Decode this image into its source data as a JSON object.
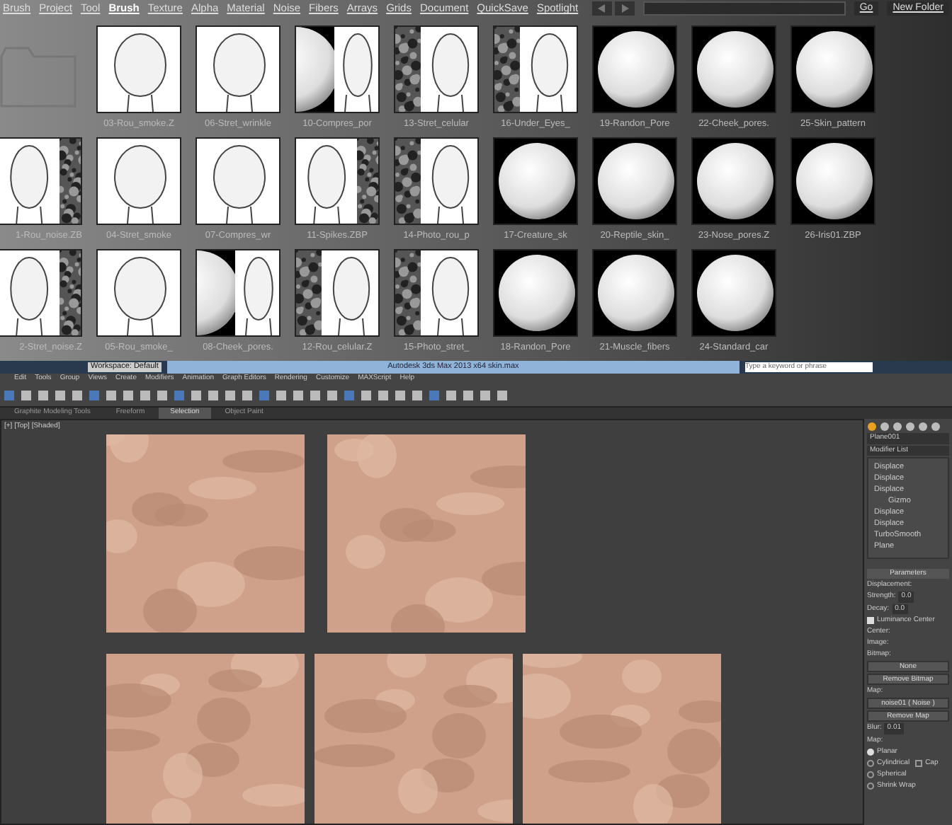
{
  "zbrush": {
    "menu": [
      {
        "label": "Brush",
        "selected": false
      },
      {
        "label": "Project",
        "selected": false
      },
      {
        "label": "Tool",
        "selected": false
      },
      {
        "label": "Brush",
        "selected": true
      },
      {
        "label": "Texture",
        "selected": false
      },
      {
        "label": "Alpha",
        "selected": false
      },
      {
        "label": "Material",
        "selected": false
      },
      {
        "label": "Noise",
        "selected": false
      },
      {
        "label": "Fibers",
        "selected": false
      },
      {
        "label": "Arrays",
        "selected": false
      },
      {
        "label": "Grids",
        "selected": false
      },
      {
        "label": "Document",
        "selected": false
      },
      {
        "label": "QuickSave",
        "selected": false
      },
      {
        "label": "Spotlight",
        "selected": false
      }
    ],
    "go_button": "Go",
    "new_folder_button": "New Folder",
    "rows": [
      {
        "lead": {
          "kind": "folder"
        },
        "items": [
          {
            "kind": "face",
            "label": "03-Rou_smoke.Z"
          },
          {
            "kind": "face",
            "label": "06-Stret_wrinkle"
          },
          {
            "kind": "sphere-face",
            "label": "10-Compres_por"
          },
          {
            "kind": "noise-face",
            "label": "13-Stret_celular"
          },
          {
            "kind": "noise-face",
            "label": "16-Under_Eyes_"
          },
          {
            "kind": "sphere",
            "label": "19-Randon_Pore"
          },
          {
            "kind": "sphere",
            "label": "22-Cheek_pores."
          },
          {
            "kind": "sphere",
            "label": "25-Skin_pattern"
          }
        ]
      },
      {
        "lead": {
          "kind": "face-noise",
          "label": "1-Rou_noise.ZB"
        },
        "items": [
          {
            "kind": "face",
            "label": "04-Stret_smoke"
          },
          {
            "kind": "face",
            "label": "07-Compres_wr"
          },
          {
            "kind": "face-noise",
            "label": "11-Spikes.ZBP"
          },
          {
            "kind": "noise-face",
            "label": "14-Photo_rou_p"
          },
          {
            "kind": "sphere",
            "label": "17-Creature_sk"
          },
          {
            "kind": "sphere",
            "label": "20-Reptile_skin_"
          },
          {
            "kind": "sphere",
            "label": "23-Nose_pores.Z"
          },
          {
            "kind": "sphere",
            "label": "26-Iris01.ZBP"
          }
        ]
      },
      {
        "lead": {
          "kind": "face-noise",
          "label": "2-Stret_noise.Z"
        },
        "items": [
          {
            "kind": "face",
            "label": "05-Rou_smoke_"
          },
          {
            "kind": "sphere-face",
            "label": "08-Cheek_pores."
          },
          {
            "kind": "noise-face",
            "label": "12-Rou_celular.Z"
          },
          {
            "kind": "noise-face",
            "label": "15-Photo_stret_"
          },
          {
            "kind": "sphere",
            "label": "18-Randon_Pore"
          },
          {
            "kind": "sphere",
            "label": "21-Muscle_fibers"
          },
          {
            "kind": "sphere",
            "label": "24-Standard_car"
          }
        ]
      }
    ]
  },
  "max": {
    "workspace": "Workspace: Default",
    "title": "Autodesk 3ds Max 2013 x64    skin.max",
    "search": {
      "placeholder": "Type a keyword or phrase"
    },
    "menu": [
      "Edit",
      "Tools",
      "Group",
      "Views",
      "Create",
      "Modifiers",
      "Animation",
      "Graph Editors",
      "Rendering",
      "Customize",
      "MAXScript",
      "Help"
    ],
    "ribbon_tabs": [
      {
        "label": "Graphite Modeling Tools",
        "selected": false
      },
      {
        "label": "Freeform",
        "selected": false
      },
      {
        "label": "Selection",
        "selected": true
      },
      {
        "label": "Object Paint",
        "selected": false
      }
    ],
    "viewport_label": "[+] [Top] [Shaded]",
    "panel": {
      "object_name": "Plane001",
      "modifier_list": "Modifier List",
      "stack": [
        {
          "label": "Displace"
        },
        {
          "label": "Displace"
        },
        {
          "label": "Displace",
          "children": [
            {
              "label": "Gizmo"
            }
          ]
        },
        {
          "label": "Displace"
        },
        {
          "label": "Displace"
        },
        {
          "label": "TurboSmooth"
        },
        {
          "label": "Plane"
        }
      ],
      "rollout": "Parameters",
      "displacement": "Displacement:",
      "strength_label": "Strength:",
      "strength": "0.0",
      "decay_label": "Decay:",
      "decay": "0.0",
      "luminance_center": {
        "label": "Luminance Center",
        "checked": true
      },
      "center_label": "Center:",
      "image": "Image:",
      "bitmap": "Bitmap:",
      "none_button": "None",
      "remove_bitmap": "Remove Bitmap",
      "map": "Map:",
      "map_button": "noise01 ( Noise )",
      "remove_map": "Remove Map",
      "blur_label": "Blur:",
      "blur": "0.01",
      "map_group": "Map:",
      "mapping": [
        {
          "label": "Planar",
          "selected": true
        },
        {
          "label": "Cylindrical",
          "selected": false
        },
        {
          "label": "Spherical",
          "selected": false
        },
        {
          "label": "Shrink Wrap",
          "selected": false
        }
      ],
      "cap": {
        "label": "Cap",
        "checked": false
      }
    }
  }
}
